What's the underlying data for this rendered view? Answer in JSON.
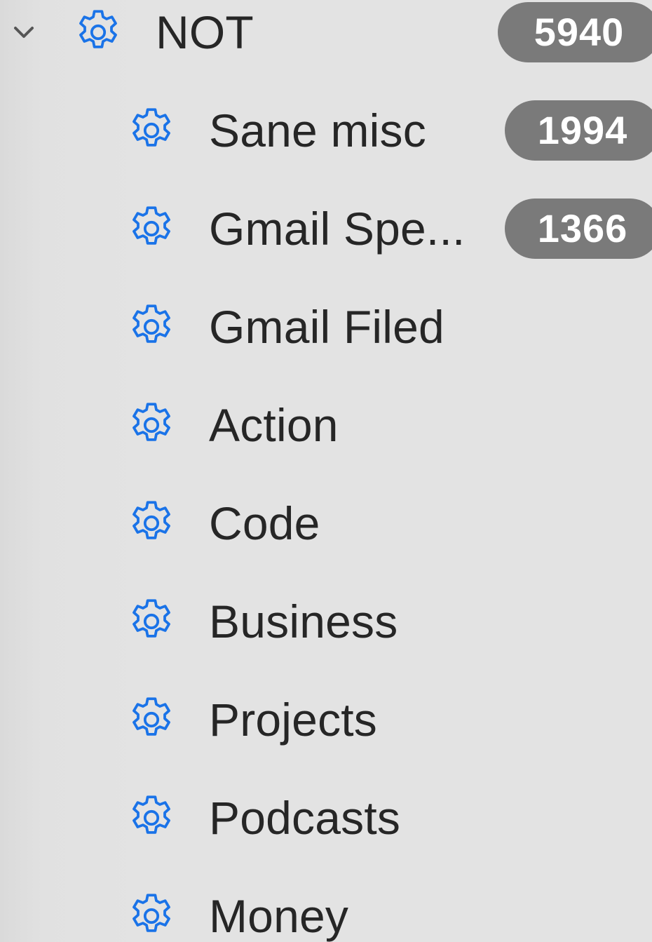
{
  "sidebar": {
    "parent": {
      "label": "NOT",
      "count": "5940",
      "expanded": true,
      "chevron_icon": "chevron-down-icon",
      "icon": "gear-icon"
    },
    "children": [
      {
        "label": "Sane misc",
        "count": "1994",
        "icon": "gear-icon"
      },
      {
        "label": "Gmail Spe...",
        "count": "1366",
        "icon": "gear-icon"
      },
      {
        "label": "Gmail Filed",
        "count": "",
        "icon": "gear-icon"
      },
      {
        "label": "Action",
        "count": "",
        "icon": "gear-icon"
      },
      {
        "label": "Code",
        "count": "",
        "icon": "gear-icon"
      },
      {
        "label": "Business",
        "count": "",
        "icon": "gear-icon"
      },
      {
        "label": "Projects",
        "count": "",
        "icon": "gear-icon"
      },
      {
        "label": "Podcasts",
        "count": "",
        "icon": "gear-icon"
      },
      {
        "label": "Money",
        "count": "",
        "icon": "gear-icon"
      }
    ]
  },
  "colors": {
    "accent": "#1a73e8",
    "badge_bg": "#7a7a7a",
    "badge_text": "#ffffff",
    "text": "#262626",
    "chevron": "#555555",
    "background": "#e3e3e3"
  }
}
